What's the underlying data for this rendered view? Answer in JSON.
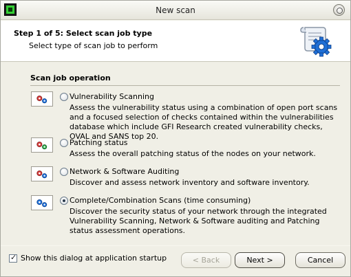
{
  "window": {
    "title": "New scan"
  },
  "header": {
    "step_title": "Step 1 of 5: Select scan job type",
    "step_subtitle": "Select type of scan job to perform"
  },
  "group": {
    "title": "Scan job operation"
  },
  "options": [
    {
      "label": "Vulnerability Scanning",
      "description": "Assess the vulnerability status using a combination of open port scans and a focused selection of checks contained within the vulnerabilities database which include GFI Research created vulnerability checks, OVAL and SANS top 20.",
      "selected": false
    },
    {
      "label": "Patching status",
      "description": "Assess the overall patching status of the nodes on your network.",
      "selected": false
    },
    {
      "label": "Network & Software Auditing",
      "description": "Discover and assess network inventory and software inventory.",
      "selected": false
    },
    {
      "label": "Complete/Combination Scans (time consuming)",
      "description": "Discover the security status of your network through the integrated Vulnerability Scanning, Network & Software auditing and Patching status assessment operations.",
      "selected": true
    }
  ],
  "footer": {
    "startup_checkbox_label": "Show this dialog at application startup",
    "startup_checked": true,
    "back_label": "< Back",
    "next_label": "Next >",
    "cancel_label": "Cancel"
  },
  "colors": {
    "window_bg": "#f0efe6",
    "header_bg": "#ffffff",
    "gear_blue": "#1f6fd6",
    "gear_red": "#d43a3a"
  },
  "icons": [
    "app-icon",
    "close-icon",
    "scroll-gear-icon",
    "gears-icon"
  ]
}
